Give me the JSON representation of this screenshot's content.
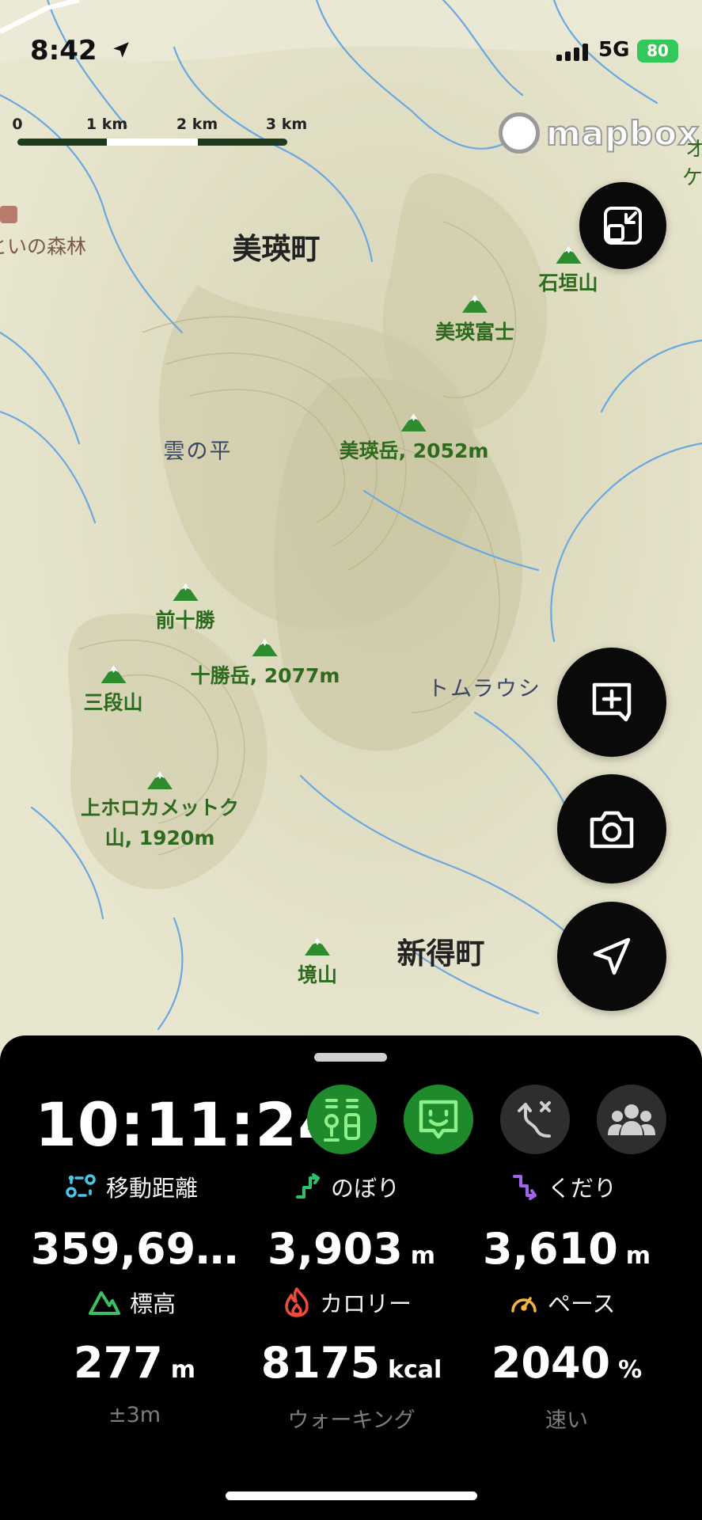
{
  "status_bar": {
    "time": "8:42",
    "network": "5G",
    "battery": "80"
  },
  "map": {
    "scale": {
      "labels": [
        "0",
        "1 km",
        "2 km",
        "3 km"
      ]
    },
    "attribution": "mapbox",
    "edge_labels": [
      "オ",
      "ケ"
    ],
    "poi_left": "といの森林",
    "towns": [
      "美瑛町",
      "新得町"
    ],
    "regions": [
      "雲の平",
      "トムラウシ"
    ],
    "peaks": [
      {
        "name": "石垣山"
      },
      {
        "name": "美瑛富士"
      },
      {
        "name": "美瑛岳, 2052m"
      },
      {
        "name": "前十勝"
      },
      {
        "name": "十勝岳, 2077m"
      },
      {
        "name": "三段山"
      },
      {
        "name": "上ホロカメットク",
        "name2": "山, 1920m"
      },
      {
        "name": "境山"
      }
    ],
    "buttons": [
      "collapse-map",
      "add-note",
      "camera",
      "locate"
    ]
  },
  "panel": {
    "elapsed_time": "10:11:24",
    "mode_buttons": [
      {
        "name": "route-guide",
        "active": true
      },
      {
        "name": "talk",
        "active": true
      },
      {
        "name": "route-off",
        "active": false
      },
      {
        "name": "group",
        "active": false
      }
    ],
    "stats": [
      {
        "key": "distance",
        "label": "移動距離",
        "value": "359,69…",
        "unit": "",
        "sub": "",
        "color": "#48c8e8"
      },
      {
        "key": "ascent",
        "label": "のぼり",
        "value": "3,903",
        "unit": "m",
        "sub": "",
        "color": "#2bc26a"
      },
      {
        "key": "descent",
        "label": "くだり",
        "value": "3,610",
        "unit": "m",
        "sub": "",
        "color": "#a064e8"
      },
      {
        "key": "elevation",
        "label": "標高",
        "value": "277",
        "unit": "m",
        "sub": "±3m",
        "color": "#3cc062"
      },
      {
        "key": "calories",
        "label": "カロリー",
        "value": "8175",
        "unit": "kcal",
        "sub": "ウォーキング",
        "color": "#f04b3a"
      },
      {
        "key": "pace",
        "label": "ペース",
        "value": "2040",
        "unit": "%",
        "sub": "速い",
        "color": "#f5b638"
      }
    ]
  }
}
